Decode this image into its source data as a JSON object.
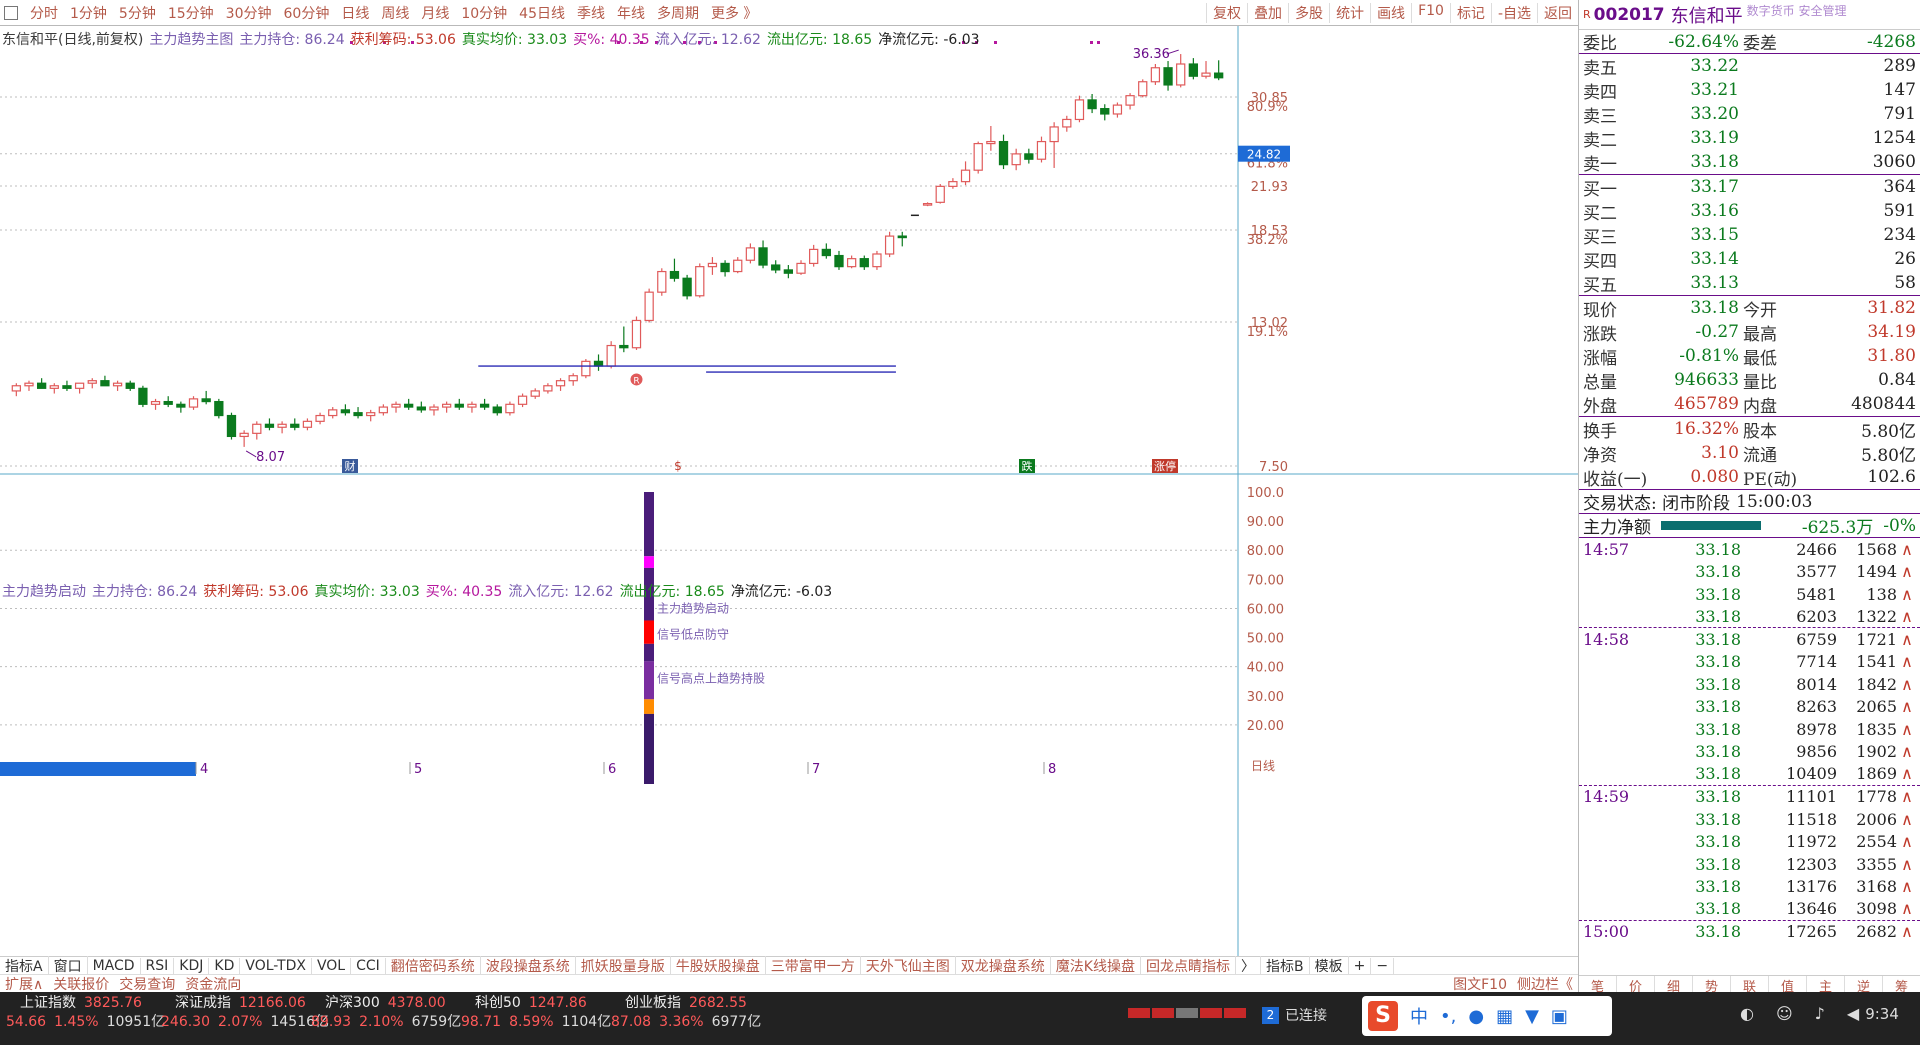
{
  "toolbar": {
    "periods": [
      "分时",
      "1分钟",
      "5分钟",
      "15分钟",
      "30分钟",
      "60分钟",
      "日线",
      "周线",
      "月线",
      "10分钟",
      "45日线",
      "季线",
      "年线",
      "多周期",
      "更多 》"
    ],
    "right": [
      "复权",
      "叠加",
      "多股",
      "统计",
      "画线",
      "F10",
      "标记",
      "-自选",
      "返回"
    ]
  },
  "main_info": {
    "items": [
      "东信和平(日线,前复权)",
      "主力趋势主图",
      "主力持仓: 86.24",
      "获利筹码: 53.06",
      "真实均价: 33.03",
      "买%: 40.35",
      "流入亿元: 12.62",
      "流出亿元: 18.65",
      "净流亿元: -6.03"
    ]
  },
  "sub_info": {
    "items": [
      "主力趋势启动",
      "主力持仓: 86.24",
      "获利筹码: 53.06",
      "真实均价: 33.03",
      "买%: 40.35",
      "流入亿元: 12.62",
      "流出亿元: 18.65",
      "净流亿元: -6.03"
    ]
  },
  "price_axis": {
    "ticks": [
      "30.85",
      "21.93",
      "18.53",
      "13.02",
      "7.50"
    ],
    "pct": [
      "80.9%",
      "61.8%",
      "38.2%",
      "19.1%"
    ],
    "current_tag": "24.82"
  },
  "sub_axis": {
    "ticks": [
      "100.0",
      "90.00",
      "80.00",
      "70.00",
      "60.00",
      "50.00",
      "40.00",
      "30.00",
      "20.00"
    ]
  },
  "annotations": {
    "high": "36.36",
    "low": "8.07",
    "signal1": "主力趋势启动",
    "signal2": "信号低点防守",
    "signal3": "信号高点上趋势持股",
    "tag_cai": "财",
    "tag_die": "跌",
    "tag_zt": "涨停",
    "tag_s": "$",
    "tag_r": "R"
  },
  "months": [
    "4",
    "5",
    "6",
    "7",
    "8"
  ],
  "period_label": "日线",
  "tabs": [
    "指标A",
    "窗口",
    "MACD",
    "RSI",
    "KDJ",
    "KD",
    "VOL-TDX",
    "VOL",
    "CCI",
    "翻倍密码系统",
    "波段操盘系统",
    "抓妖股量身版",
    "牛股妖股操盘",
    "三带富甲一方",
    "天外飞仙主图",
    "双龙操盘系统",
    "魔法K线操盘",
    "回龙点睛指标",
    "〉",
    "指标B",
    "模板",
    "+",
    "−"
  ],
  "tabs2": [
    "扩展∧",
    "关联报价",
    "交易查询",
    "资金流向"
  ],
  "tabs2_right": [
    "图文F10",
    "侧边栏《"
  ],
  "stock": {
    "code": "002017",
    "name": "东信和平",
    "badge": "R",
    "topright": "数字货币 安全管理"
  },
  "weibi": {
    "label1": "委比",
    "val1": "-62.64%",
    "label2": "委差",
    "val2": "-4268"
  },
  "sells": [
    {
      "l": "卖五",
      "p": "33.22",
      "v": "289"
    },
    {
      "l": "卖四",
      "p": "33.21",
      "v": "147"
    },
    {
      "l": "卖三",
      "p": "33.20",
      "v": "791"
    },
    {
      "l": "卖二",
      "p": "33.19",
      "v": "1254"
    },
    {
      "l": "卖一",
      "p": "33.18",
      "v": "3060"
    }
  ],
  "buys": [
    {
      "l": "买一",
      "p": "33.17",
      "v": "364"
    },
    {
      "l": "买二",
      "p": "33.16",
      "v": "591"
    },
    {
      "l": "买三",
      "p": "33.15",
      "v": "234"
    },
    {
      "l": "买四",
      "p": "33.14",
      "v": "26"
    },
    {
      "l": "买五",
      "p": "33.13",
      "v": "58"
    }
  ],
  "quote": [
    {
      "l1": "现价",
      "v1": "33.18",
      "l2": "今开",
      "v2": "31.82",
      "c2": "#c0392b"
    },
    {
      "l1": "涨跌",
      "v1": "-0.27",
      "l2": "最高",
      "v2": "34.19",
      "c2": "#c0392b"
    },
    {
      "l1": "涨幅",
      "v1": "-0.81%",
      "l2": "最低",
      "v2": "31.80",
      "c2": "#c0392b"
    },
    {
      "l1": "总量",
      "v1": "946633",
      "l2": "量比",
      "v2": "0.84",
      "c2": "#222"
    },
    {
      "l1": "外盘",
      "v1": "465789",
      "l2": "内盘",
      "v2": "480844",
      "c2": "#222"
    }
  ],
  "quote2": [
    {
      "l1": "换手",
      "v1": "16.32%",
      "l2": "股本",
      "v2": "5.80亿"
    },
    {
      "l1": "净资",
      "v1": "3.10",
      "l2": "流通",
      "v2": "5.80亿"
    },
    {
      "l1": "收益(一)",
      "v1": "0.080",
      "l2": "PE(动)",
      "v2": "102.6"
    }
  ],
  "status": {
    "label": "交易状态: 闭市阶段",
    "time": "15:00:03"
  },
  "mainflow": {
    "label": "主力净额",
    "value": "-625.3万",
    "pct": "-0%"
  },
  "ticks": [
    {
      "t": "14:57",
      "p": "33.18",
      "v": "2466",
      "n": "1568"
    },
    {
      "t": "",
      "p": "33.18",
      "v": "3577",
      "n": "1494"
    },
    {
      "t": "",
      "p": "33.18",
      "v": "5481",
      "n": "138"
    },
    {
      "t": "",
      "p": "33.18",
      "v": "6203",
      "n": "1322"
    },
    {
      "t": "14:58",
      "p": "33.18",
      "v": "6759",
      "n": "1721"
    },
    {
      "t": "",
      "p": "33.18",
      "v": "7714",
      "n": "1541"
    },
    {
      "t": "",
      "p": "33.18",
      "v": "8014",
      "n": "1842"
    },
    {
      "t": "",
      "p": "33.18",
      "v": "8263",
      "n": "2065"
    },
    {
      "t": "",
      "p": "33.18",
      "v": "8978",
      "n": "1835"
    },
    {
      "t": "",
      "p": "33.18",
      "v": "9856",
      "n": "1902"
    },
    {
      "t": "",
      "p": "33.18",
      "v": "10409",
      "n": "1869"
    },
    {
      "t": "14:59",
      "p": "33.18",
      "v": "11101",
      "n": "1778"
    },
    {
      "t": "",
      "p": "33.18",
      "v": "11518",
      "n": "2006"
    },
    {
      "t": "",
      "p": "33.18",
      "v": "11972",
      "n": "2554"
    },
    {
      "t": "",
      "p": "33.18",
      "v": "12303",
      "n": "3355"
    },
    {
      "t": "",
      "p": "33.18",
      "v": "13176",
      "n": "3168"
    },
    {
      "t": "",
      "p": "33.18",
      "v": "13646",
      "n": "3098"
    },
    {
      "t": "15:00",
      "p": "33.18",
      "v": "17265",
      "n": "2682"
    }
  ],
  "bottom_tabs": [
    "笔",
    "价",
    "细",
    "势",
    "联",
    "值",
    "主",
    "逆",
    "筹"
  ],
  "indices": [
    {
      "name": "上证指数",
      "val": "3825.76",
      "chg": "54.66",
      "pct": "1.45%",
      "amt": "10951亿"
    },
    {
      "name": "深证成指",
      "val": "12166.06",
      "chg": "246.30",
      "pct": "2.07%",
      "amt": "14516亿"
    },
    {
      "name": "沪深300",
      "val": "4378.00",
      "chg": "89.93",
      "pct": "2.10%",
      "amt": "6759亿"
    },
    {
      "name": "科创50",
      "val": "1247.86",
      "chg": "98.71",
      "pct": "8.59%",
      "amt": "1104亿"
    },
    {
      "name": "创业板指",
      "val": "2682.55",
      "chg": "87.08",
      "pct": "3.36%",
      "amt": "6977亿"
    }
  ],
  "connection": "已连接",
  "clock": "9:34",
  "chart_data": {
    "type": "candlestick",
    "title": "东信和平(日线,前复权)",
    "x_months": [
      "4",
      "5",
      "6",
      "7",
      "8"
    ],
    "price_ylim": [
      7.5,
      36.36
    ],
    "last_close": 33.18,
    "high": 36.36,
    "low": 8.07,
    "candles": [
      [
        10.0,
        10.3,
        9.8,
        10.2
      ],
      [
        10.2,
        10.4,
        10.0,
        10.3
      ],
      [
        10.3,
        10.5,
        10.1,
        10.1
      ],
      [
        10.1,
        10.3,
        9.9,
        10.2
      ],
      [
        10.2,
        10.4,
        10.0,
        10.1
      ],
      [
        10.1,
        10.3,
        9.9,
        10.3
      ],
      [
        10.3,
        10.5,
        10.1,
        10.4
      ],
      [
        10.4,
        10.6,
        10.2,
        10.2
      ],
      [
        10.2,
        10.4,
        10.0,
        10.3
      ],
      [
        10.3,
        10.4,
        10.0,
        10.1
      ],
      [
        10.1,
        10.2,
        9.4,
        9.5
      ],
      [
        9.5,
        9.7,
        9.3,
        9.6
      ],
      [
        9.6,
        9.8,
        9.4,
        9.5
      ],
      [
        9.5,
        9.6,
        9.2,
        9.4
      ],
      [
        9.4,
        9.8,
        9.3,
        9.7
      ],
      [
        9.7,
        10.0,
        9.5,
        9.6
      ],
      [
        9.6,
        9.7,
        9.0,
        9.1
      ],
      [
        9.1,
        9.2,
        8.3,
        8.4
      ],
      [
        8.4,
        8.6,
        8.07,
        8.5
      ],
      [
        8.5,
        8.9,
        8.3,
        8.8
      ],
      [
        8.8,
        9.0,
        8.6,
        8.7
      ],
      [
        8.7,
        8.9,
        8.5,
        8.8
      ],
      [
        8.8,
        9.0,
        8.6,
        8.7
      ],
      [
        8.7,
        9.0,
        8.6,
        8.9
      ],
      [
        8.9,
        9.2,
        8.8,
        9.1
      ],
      [
        9.1,
        9.4,
        9.0,
        9.3
      ],
      [
        9.3,
        9.5,
        9.1,
        9.2
      ],
      [
        9.2,
        9.4,
        9.0,
        9.1
      ],
      [
        9.1,
        9.3,
        8.9,
        9.2
      ],
      [
        9.2,
        9.5,
        9.1,
        9.4
      ],
      [
        9.4,
        9.6,
        9.2,
        9.5
      ],
      [
        9.5,
        9.7,
        9.3,
        9.4
      ],
      [
        9.4,
        9.6,
        9.2,
        9.3
      ],
      [
        9.3,
        9.5,
        9.1,
        9.4
      ],
      [
        9.4,
        9.6,
        9.2,
        9.5
      ],
      [
        9.5,
        9.7,
        9.3,
        9.4
      ],
      [
        9.4,
        9.6,
        9.2,
        9.5
      ],
      [
        9.5,
        9.7,
        9.3,
        9.4
      ],
      [
        9.4,
        9.5,
        9.1,
        9.2
      ],
      [
        9.2,
        9.6,
        9.1,
        9.5
      ],
      [
        9.5,
        9.9,
        9.4,
        9.8
      ],
      [
        9.8,
        10.1,
        9.7,
        10.0
      ],
      [
        10.0,
        10.3,
        9.9,
        10.2
      ],
      [
        10.2,
        10.5,
        10.0,
        10.4
      ],
      [
        10.4,
        10.7,
        10.2,
        10.6
      ],
      [
        10.6,
        11.3,
        10.5,
        11.2
      ],
      [
        11.2,
        11.5,
        10.8,
        11.0
      ],
      [
        11.0,
        12.1,
        10.9,
        11.9
      ],
      [
        11.9,
        12.8,
        11.6,
        11.8
      ],
      [
        11.8,
        13.3,
        11.7,
        13.1
      ],
      [
        13.1,
        14.8,
        13.0,
        14.6
      ],
      [
        14.6,
        16.0,
        14.4,
        15.8
      ],
      [
        15.8,
        16.6,
        15.2,
        15.4
      ],
      [
        15.4,
        15.6,
        14.2,
        14.4
      ],
      [
        14.4,
        16.3,
        14.3,
        16.1
      ],
      [
        16.1,
        16.7,
        15.6,
        16.3
      ],
      [
        16.3,
        16.5,
        15.5,
        15.8
      ],
      [
        15.8,
        16.7,
        15.7,
        16.5
      ],
      [
        16.5,
        17.6,
        16.3,
        17.3
      ],
      [
        17.3,
        17.8,
        16.0,
        16.2
      ],
      [
        16.2,
        16.5,
        15.7,
        15.9
      ],
      [
        15.9,
        16.2,
        15.4,
        15.7
      ],
      [
        15.7,
        16.5,
        15.6,
        16.3
      ],
      [
        16.3,
        17.5,
        16.1,
        17.2
      ],
      [
        17.2,
        17.6,
        16.6,
        16.8
      ],
      [
        16.8,
        17.1,
        15.9,
        16.1
      ],
      [
        16.1,
        16.8,
        16.0,
        16.6
      ],
      [
        16.6,
        16.8,
        15.9,
        16.1
      ],
      [
        16.1,
        17.1,
        15.9,
        16.9
      ],
      [
        16.9,
        18.4,
        16.7,
        18.1
      ],
      [
        18.1,
        18.4,
        17.4,
        18.0
      ],
      [
        null,
        null,
        null,
        null
      ],
      [
        20.4,
        20.6,
        20.3,
        20.5
      ],
      [
        20.6,
        22.1,
        20.5,
        21.9
      ],
      [
        21.9,
        22.6,
        21.7,
        22.3
      ],
      [
        22.3,
        24.1,
        22.0,
        23.3
      ],
      [
        23.3,
        26.0,
        23.0,
        25.8
      ],
      [
        25.8,
        27.6,
        25.1,
        26.0
      ],
      [
        26.0,
        26.7,
        23.4,
        23.8
      ],
      [
        23.8,
        25.3,
        23.3,
        24.8
      ],
      [
        24.8,
        25.3,
        23.9,
        24.3
      ],
      [
        24.3,
        26.5,
        24.0,
        26.0
      ],
      [
        26.0,
        28.0,
        23.5,
        27.5
      ],
      [
        27.5,
        28.7,
        27.0,
        28.3
      ],
      [
        28.3,
        31.0,
        28.0,
        30.5
      ],
      [
        30.5,
        31.2,
        29.0,
        29.5
      ],
      [
        29.5,
        30.0,
        28.2,
        28.9
      ],
      [
        28.9,
        30.2,
        28.5,
        29.9
      ],
      [
        29.9,
        31.3,
        29.4,
        31.0
      ],
      [
        31.0,
        33.0,
        30.8,
        32.7
      ],
      [
        32.7,
        35.0,
        32.3,
        34.5
      ],
      [
        34.5,
        35.4,
        31.6,
        32.3
      ],
      [
        32.3,
        36.36,
        32.0,
        35.0
      ],
      [
        35.0,
        35.8,
        33.0,
        33.4
      ],
      [
        33.4,
        35.4,
        33.1,
        33.8
      ],
      [
        33.8,
        35.5,
        32.9,
        33.2
      ]
    ]
  }
}
